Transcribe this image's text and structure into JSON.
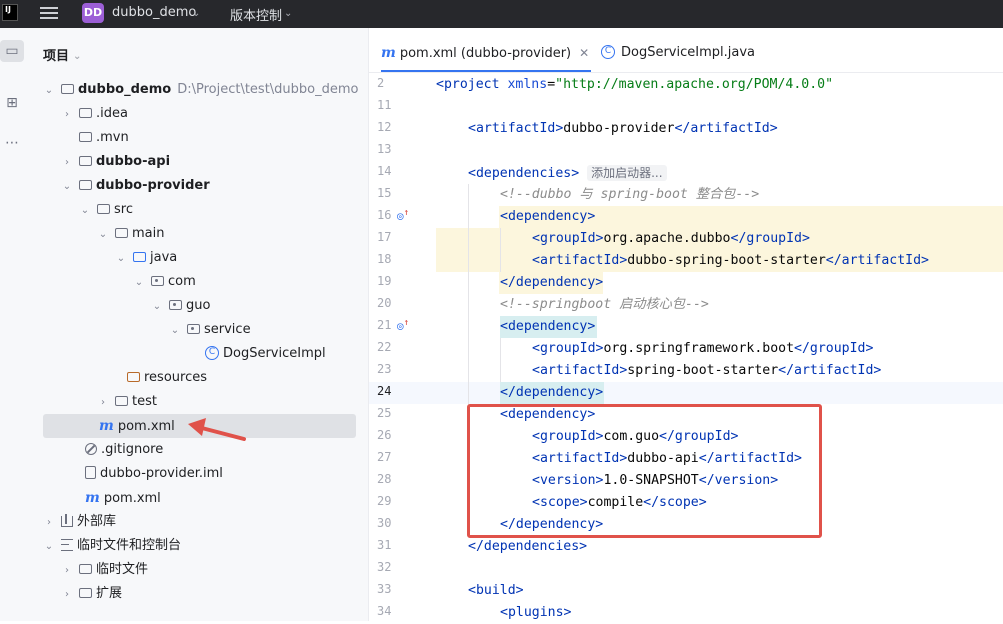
{
  "titlebar": {
    "logo": "IJ",
    "project_badge": "DD",
    "project_name": "dubbo_demo",
    "vcs_label": "版本控制"
  },
  "project_panel": {
    "title": "项目",
    "tree": [
      {
        "label": "dubbo_demo",
        "path": "D:\\Project\\test\\dubbo_demo"
      },
      {
        "label": ".idea"
      },
      {
        "label": ".mvn"
      },
      {
        "label": "dubbo-api"
      },
      {
        "label": "dubbo-provider"
      },
      {
        "label": "src"
      },
      {
        "label": "main"
      },
      {
        "label": "java"
      },
      {
        "label": "com"
      },
      {
        "label": "guo"
      },
      {
        "label": "service"
      },
      {
        "label": "DogServiceImpl"
      },
      {
        "label": "resources"
      },
      {
        "label": "test"
      },
      {
        "label": "pom.xml"
      },
      {
        "label": ".gitignore"
      },
      {
        "label": "dubbo-provider.iml"
      },
      {
        "label": "pom.xml"
      },
      {
        "label": "外部库"
      },
      {
        "label": "临时文件和控制台"
      },
      {
        "label": "临时文件"
      },
      {
        "label": "扩展"
      }
    ]
  },
  "editor": {
    "tabs": [
      {
        "label": "pom.xml (dubbo-provider)",
        "active": true
      },
      {
        "label": "DogServiceImpl.java",
        "active": false
      }
    ],
    "hint_label": "添加启动器...",
    "line_numbers": [
      "2",
      "11",
      "12",
      "13",
      "14",
      "15",
      "16",
      "17",
      "18",
      "19",
      "20",
      "21",
      "22",
      "23",
      "24",
      "25",
      "26",
      "27",
      "28",
      "29",
      "30",
      "31",
      "32",
      "33",
      "34"
    ],
    "lines": {
      "l2_tag": "<project",
      "l2_attr": "xmlns",
      "l2_eq": "=",
      "l2_val": "\"http://maven.apache.org/POM/4.0.0\"",
      "l12_open": "<artifactId>",
      "l12_text": "dubbo-provider",
      "l12_close": "</artifactId>",
      "l14_open": "<dependencies>",
      "l15": "<!--dubbo 与 spring-boot 整合包-->",
      "l16": "<dependency>",
      "l17_open": "<groupId>",
      "l17_text": "org.apache.dubbo",
      "l17_close": "</groupId>",
      "l18_open": "<artifactId>",
      "l18_text": "dubbo-spring-boot-starter",
      "l18_close": "</artifactId>",
      "l19": "</dependency>",
      "l20": "<!--springboot 启动核心包-->",
      "l21": "<dependency>",
      "l22_open": "<groupId>",
      "l22_text": "org.springframework.boot",
      "l22_close": "</groupId>",
      "l23_open": "<artifactId>",
      "l23_text": "spring-boot-starter",
      "l23_close": "</artifactId>",
      "l24": "</dependency>",
      "l25": "<dependency>",
      "l26_open": "<groupId>",
      "l26_text": "com.guo",
      "l26_close": "</groupId>",
      "l27_open": "<artifactId>",
      "l27_text": "dubbo-api",
      "l27_close": "</artifactId>",
      "l28_open": "<version>",
      "l28_text": "1.0-SNAPSHOT",
      "l28_close": "</version>",
      "l29_open": "<scope>",
      "l29_text": "compile",
      "l29_close": "</scope>",
      "l30": "</dependency>",
      "l31": "</dependencies>",
      "l33": "<build>",
      "l34": "<plugins>"
    }
  },
  "colors": {
    "tag": "#0033b3",
    "string": "#067d17",
    "comment": "#8c8c8c",
    "highlight_box": "#e0524a",
    "arrow": "#e0524a",
    "accent": "#3574f0"
  }
}
